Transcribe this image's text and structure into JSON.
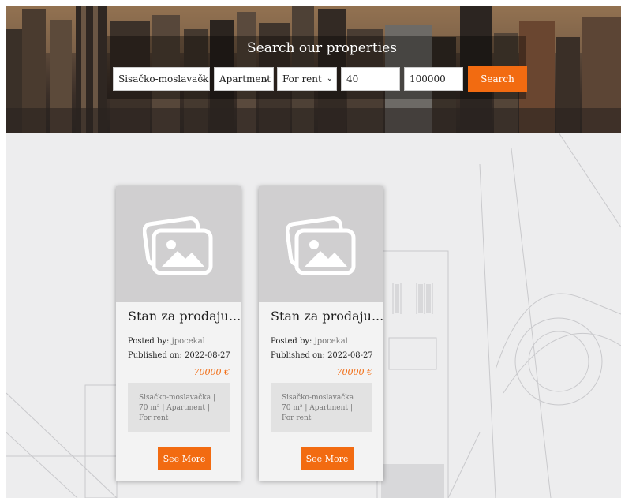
{
  "hero": {
    "title": "Search our properties",
    "location_value": "Sisačko-moslavačka",
    "type_value": "Apartment",
    "status_value": "For rent",
    "min_value": "40",
    "max_value": "100000",
    "search_label": "Search"
  },
  "labels": {
    "posted_by": "Posted by:",
    "published_on": "Published on:"
  },
  "listings": [
    {
      "title": "Stan za prodaju...",
      "posted_by": "jpocekal",
      "published_on": "2022-08-27",
      "price": "70000 €",
      "details": "Sisačko-moslavačka | 70 m² | Apartment | For rent",
      "see_more": "See More"
    },
    {
      "title": "Stan za prodaju...",
      "posted_by": "jpocekal",
      "published_on": "2022-08-27",
      "price": "70000 €",
      "details": "Sisačko-moslavačka | 70 m² | Apartment | For rent",
      "see_more": "See More"
    }
  ],
  "colors": {
    "accent": "#f26b11",
    "placeholder": "#d0cfd0",
    "page_bg": "#ededee"
  },
  "icons": {
    "listing_image": "image-placeholder-icon",
    "dropdown": "chevron-down-icon"
  }
}
